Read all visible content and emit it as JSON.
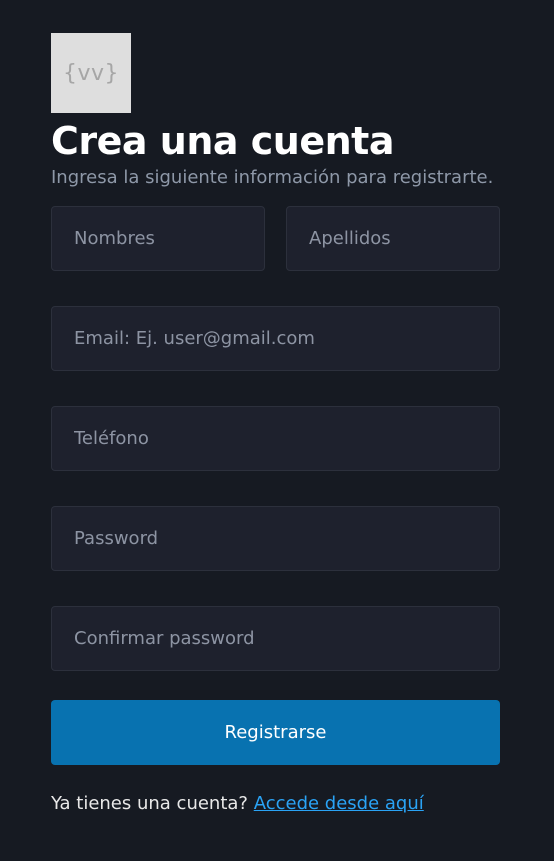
{
  "logo": {
    "text": "{vv}"
  },
  "header": {
    "title": "Crea una cuenta",
    "subtitle": "Ingresa la siguiente información para registrarte."
  },
  "form": {
    "first_name": {
      "placeholder": "Nombres",
      "value": ""
    },
    "last_name": {
      "placeholder": "Apellidos",
      "value": ""
    },
    "email": {
      "placeholder": "Email: Ej. user@gmail.com",
      "value": ""
    },
    "phone": {
      "placeholder": "Teléfono",
      "value": ""
    },
    "password": {
      "placeholder": "Password",
      "value": ""
    },
    "confirm_password": {
      "placeholder": "Confirmar password",
      "value": ""
    },
    "submit_label": "Registrarse"
  },
  "footer": {
    "prompt": "Ya tienes una cuenta?",
    "link_label": "Accede desde aquí"
  },
  "colors": {
    "background": "#161a22",
    "input_background": "#1e212d",
    "primary_button": "#0872b0",
    "link": "#2aa3f5"
  }
}
